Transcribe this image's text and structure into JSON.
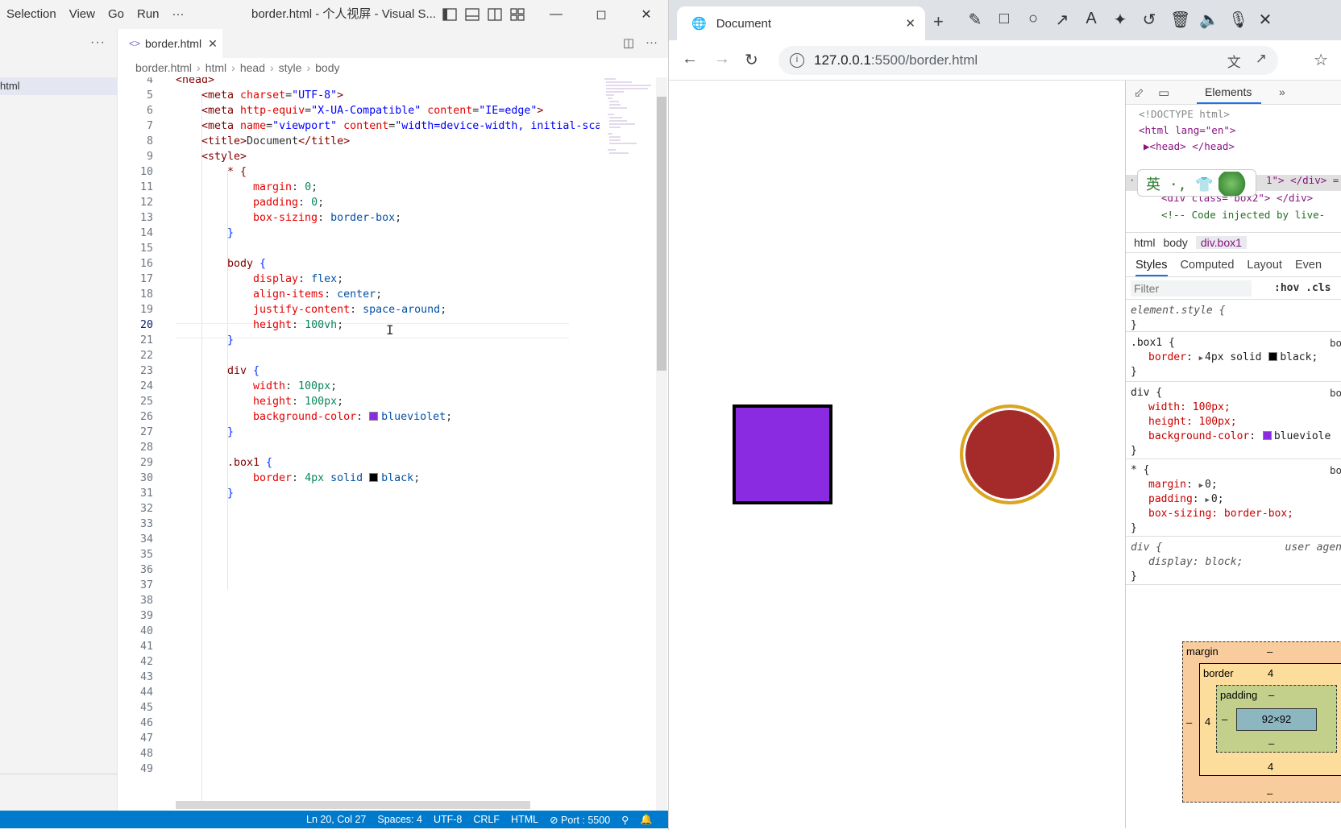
{
  "vscode": {
    "menu": [
      "Selection",
      "View",
      "Go",
      "Run",
      "···"
    ],
    "window_title": "border.html - 个人视屏 - Visual S...",
    "sidebar_more": "···",
    "sidebar_file": "html",
    "tab_label": "border.html",
    "breadcrumb": [
      "border.html",
      "html",
      "head",
      "style",
      "body"
    ],
    "line_numbers": [
      "4",
      "5",
      "6",
      "7",
      "8",
      "9",
      "10",
      "11",
      "12",
      "13",
      "14",
      "15",
      "16",
      "17",
      "18",
      "19",
      "20",
      "21",
      "22",
      "23",
      "24",
      "25",
      "26",
      "27",
      "28",
      "29",
      "30",
      "31",
      "32",
      "33",
      "34",
      "35",
      "36",
      "37",
      "38",
      "39",
      "40",
      "41",
      "42",
      "43",
      "44",
      "45",
      "46",
      "47",
      "48",
      "49"
    ],
    "current_line": "20",
    "code": {
      "l4": "<head>",
      "l5_tag": "<meta",
      "l5_attr": "charset",
      "l5_val": "\"UTF-8\"",
      "l6_attr1": "http-equiv",
      "l6_val1": "\"X-UA-Compatible\"",
      "l6_attr2": "content",
      "l6_val2": "\"IE=edge\"",
      "l7_attr1": "name",
      "l7_val1": "\"viewport\"",
      "l7_attr2": "content",
      "l7_val2": "\"width=device-width, initial-sca",
      "l8_open": "<title>",
      "l8_text": "Document",
      "l8_close": "</title>",
      "l9": "<style>",
      "l10": "* {",
      "l11_prop": "margin",
      "l11_val": "0",
      "l12_prop": "padding",
      "l12_val": "0",
      "l13_prop": "box-sizing",
      "l13_val": "border-box",
      "l14": "}",
      "l16_sel": "body",
      "l16_br": "{",
      "l17_prop": "display",
      "l17_val": "flex",
      "l18_prop": "align-items",
      "l18_val": "center",
      "l19_prop": "justify-content",
      "l19_val": "space-around",
      "l20_prop": "height",
      "l20_val": "100vh",
      "l21": "}",
      "l23_sel": "div",
      "l23_br": "{",
      "l24_prop": "width",
      "l24_val": "100px",
      "l25_prop": "height",
      "l25_val": "100px",
      "l26_prop": "background-color",
      "l26_val": "blueviolet",
      "l27": "}",
      "l29_sel": ".box1",
      "l29_br": "{",
      "l30_prop": "border",
      "l30_val1": "4px",
      "l30_val2": "solid",
      "l30_val3": "black",
      "l31": "}"
    },
    "status": [
      "Ln 20, Col 27",
      "Spaces: 4",
      "UTF-8",
      "CRLF",
      "HTML",
      "⊘ Port : 5500"
    ]
  },
  "browser": {
    "tab_title": "Document",
    "url_host": "127.0.0.1",
    "url_rest": ":5500/border.html",
    "box1_color": "#8a2be2",
    "box2_color": "#a52a2a",
    "box2_border": "#daa520"
  },
  "devtools": {
    "panel_tab": "Elements",
    "dom": {
      "doctype": "<!DOCTYPE html>",
      "html_open": "<html lang=\"en\">",
      "head": "<head> </head>",
      "box1_tail": "1\"> </div> =",
      "box2": "<div class=\"box2\"> </div>",
      "comment": "<!-- Code injected by live-"
    },
    "crumbs": [
      "html",
      "body",
      "div.box1"
    ],
    "subtabs": [
      "Styles",
      "Computed",
      "Layout",
      "Even"
    ],
    "filter_placeholder": "Filter",
    "hov_cls": ":hov  .cls",
    "rules": {
      "element_style": "element.style {",
      "close": "}",
      "box1_sel": ".box1 {",
      "box1_prop": "border",
      "box1_val": "4px solid",
      "box1_color": "black;",
      "src": "bo",
      "div_sel": "div {",
      "div_w": "width: 100px;",
      "div_h": "height: 100px;",
      "div_bg_prop": "background-color",
      "div_bg_val": "blueviole",
      "star_sel": "* {",
      "star_m": "margin",
      "star_m_val": "0;",
      "star_p": "padding",
      "star_p_val": "0;",
      "star_bs": "box-sizing: border-box;",
      "ua_sel": "div {",
      "ua_src": "user agen",
      "ua_decl": "display: block;"
    },
    "boxmodel": {
      "margin_label": "margin",
      "margin_val": "–",
      "border_label": "border",
      "border_val": "4",
      "padding_label": "padding",
      "padding_val": "–",
      "content": "92×92",
      "side_dash": "–"
    }
  }
}
